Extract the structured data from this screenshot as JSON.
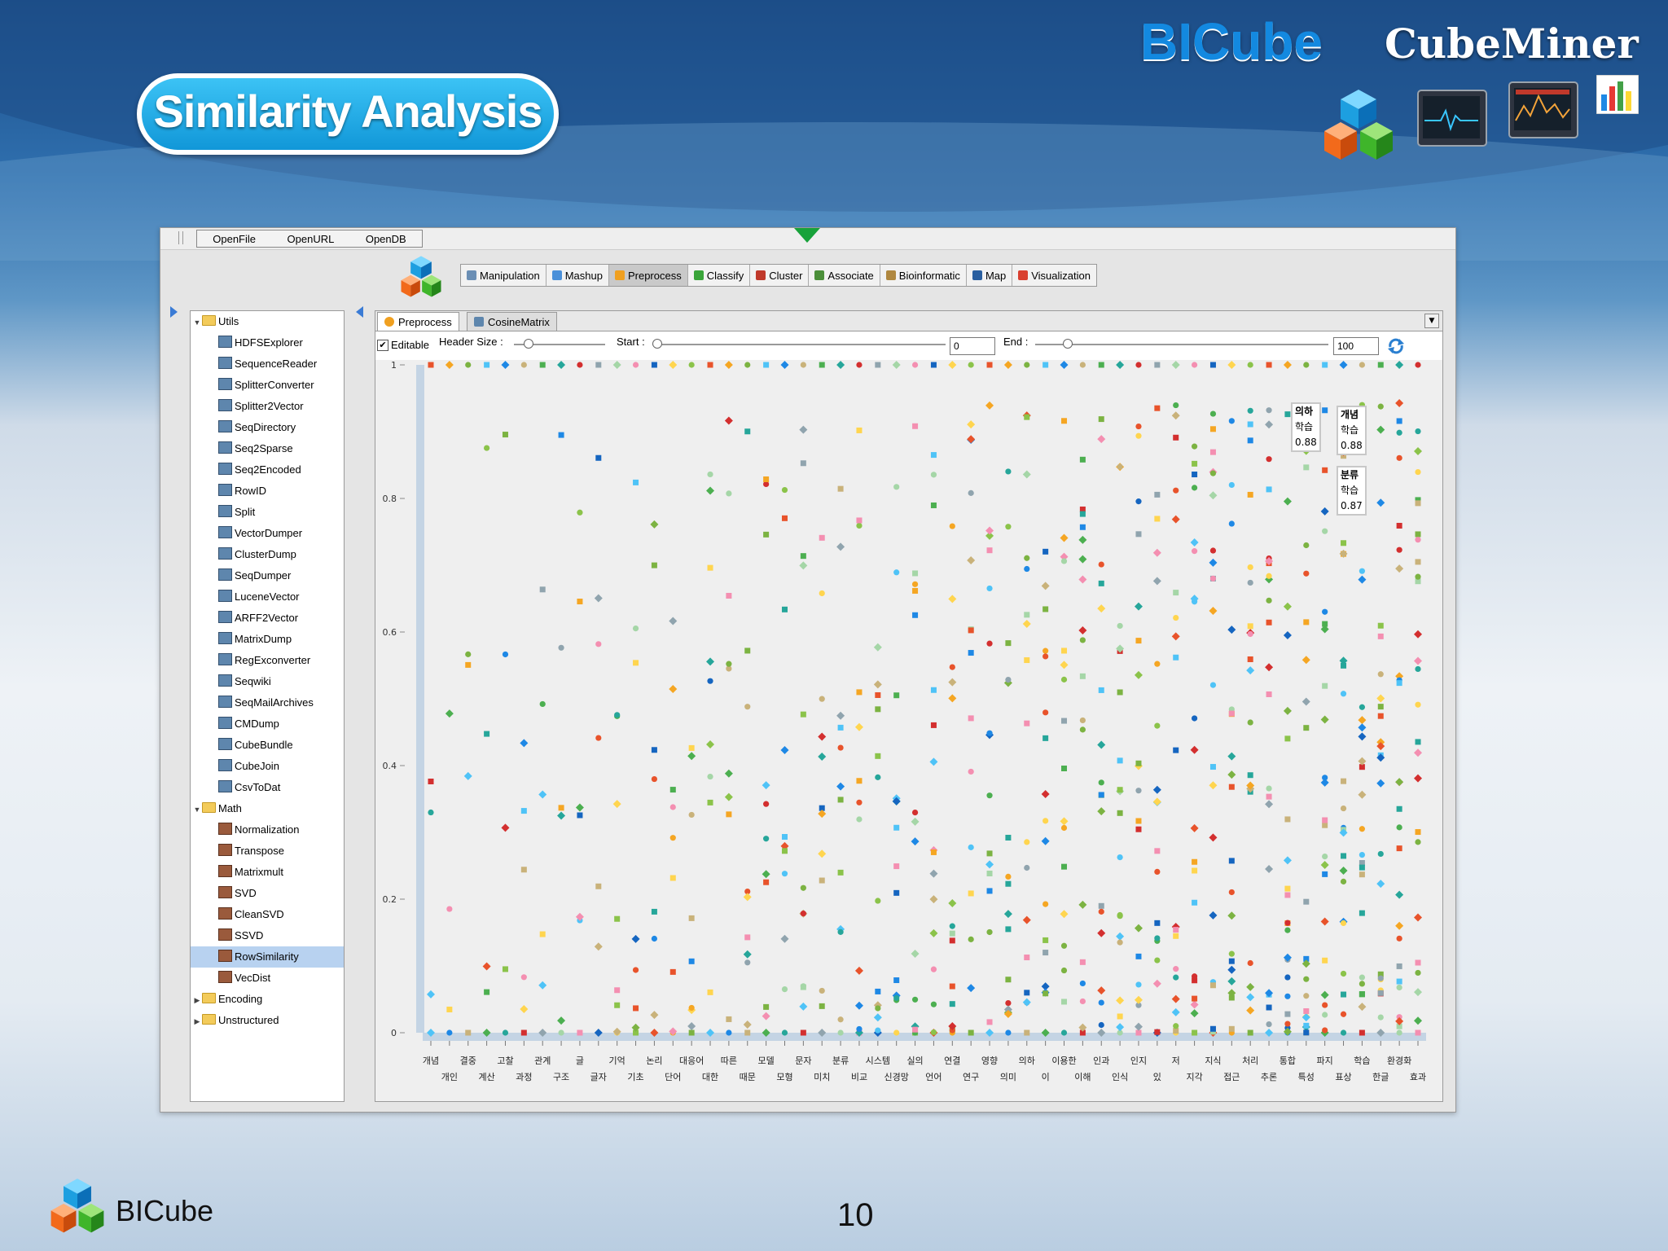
{
  "slide": {
    "title": "Similarity Analysis",
    "brand": "BICube",
    "product": "CubeMiner",
    "footer_brand": "BICube",
    "page_number": "10"
  },
  "app": {
    "menu": [
      "OpenFile",
      "OpenURL",
      "OpenDB"
    ],
    "toolbar": [
      {
        "label": "Manipulation",
        "icon": "manipulation-icon",
        "color": "#6b8fb5"
      },
      {
        "label": "Mashup",
        "icon": "mashup-icon",
        "color": "#4a90d9"
      },
      {
        "label": "Preprocess",
        "icon": "preprocess-icon",
        "color": "#f0a020",
        "active": true
      },
      {
        "label": "Classify",
        "icon": "classify-icon",
        "color": "#3aa53a"
      },
      {
        "label": "Cluster",
        "icon": "cluster-icon",
        "color": "#c0392b"
      },
      {
        "label": "Associate",
        "icon": "associate-icon",
        "color": "#4b8f3a"
      },
      {
        "label": "Bioinformatic",
        "icon": "bioinformatic-icon",
        "color": "#b08840"
      },
      {
        "label": "Map",
        "icon": "map-icon",
        "color": "#2a5fa0"
      },
      {
        "label": "Visualization",
        "icon": "visualization-icon",
        "color": "#d94030"
      }
    ],
    "tree": {
      "utils_label": "Utils",
      "utils": [
        "HDFSExplorer",
        "SequenceReader",
        "SplitterConverter",
        "Splitter2Vector",
        "SeqDirectory",
        "Seq2Sparse",
        "Seq2Encoded",
        "RowID",
        "Split",
        "VectorDumper",
        "ClusterDump",
        "SeqDumper",
        "LuceneVector",
        "ARFF2Vector",
        "MatrixDump",
        "RegExconverter",
        "Seqwiki",
        "SeqMailArchives",
        "CMDump",
        "CubeBundle",
        "CubeJoin",
        "CsvToDat"
      ],
      "math_label": "Math",
      "math": [
        "Normalization",
        "Transpose",
        "Matrixmult",
        "SVD",
        "CleanSVD",
        "SSVD",
        "RowSimilarity",
        "VecDist"
      ],
      "selected": "RowSimilarity",
      "collapsed": [
        "Encoding",
        "Unstructured"
      ]
    },
    "tabs": [
      "Preprocess",
      "CosineMatrix"
    ],
    "controls": {
      "editable_label": "Editable",
      "editable_checked": "✔",
      "header_size_label": "Header Size :",
      "start_label": "Start :",
      "start_value": "0",
      "end_label": "End :",
      "end_value": "100"
    },
    "callouts": [
      {
        "w1": "의하",
        "w2": "학습",
        "value": "0.88"
      },
      {
        "w1": "개념",
        "w2": "학습",
        "value": "0.88"
      },
      {
        "w1": "분류",
        "w2": "학습",
        "value": "0.87"
      }
    ]
  },
  "chart_data": {
    "type": "scatter",
    "title": "",
    "ylim": [
      0,
      1
    ],
    "yticks": [
      "0",
      "0.2",
      "0.4",
      "0.6",
      "0.8",
      "1"
    ],
    "x_top": [
      "개념",
      "결중",
      "고찰",
      "관계",
      "글",
      "기억",
      "논리",
      "대응어",
      "따른",
      "모델",
      "문자",
      "분류",
      "시스템",
      "실의",
      "연결",
      "영향",
      "의하",
      "이용한",
      "인과",
      "인지",
      "저",
      "지식",
      "처리",
      "통합",
      "파지",
      "학습",
      "환경화"
    ],
    "x_bottom": [
      "개인",
      "계산",
      "과정",
      "구조",
      "글자",
      "기초",
      "단어",
      "대한",
      "때문",
      "모형",
      "미치",
      "비교",
      "신경망",
      "언어",
      "연구",
      "의미",
      "이",
      "이해",
      "인식",
      "있",
      "지각",
      "접근",
      "추론",
      "특성",
      "표상",
      "한글",
      "효과"
    ],
    "series_colors": [
      "#e8532b",
      "#f5a623",
      "#7cb342",
      "#4fc3f7",
      "#1e88e5",
      "#c9b27a",
      "#4caf50",
      "#26a69a",
      "#d32f2f",
      "#90a4ae",
      "#a5d6a7",
      "#f48fb1",
      "#1565c0",
      "#ffd54f",
      "#8bc34a"
    ],
    "points_note": "",
    "x_count": 54
  }
}
